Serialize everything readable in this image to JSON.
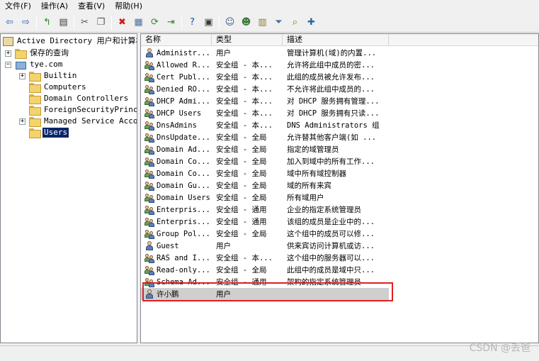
{
  "menubar": {
    "items": [
      "文件(F)",
      "操作(A)",
      "查看(V)",
      "帮助(H)"
    ]
  },
  "toolbar": {
    "buttons": [
      {
        "name": "back-arrow-icon",
        "glyph": "⇦",
        "color": "#2b5fb0"
      },
      {
        "name": "forward-arrow-icon",
        "glyph": "⇨",
        "color": "#2b5fb0"
      },
      {
        "name": "up-folder-icon",
        "glyph": "↰",
        "color": "#2c8a2c"
      },
      {
        "name": "show-console-tree-icon",
        "glyph": "▤",
        "color": "#3a3a3a"
      },
      {
        "name": "cut-icon",
        "glyph": "✂",
        "color": "#555555"
      },
      {
        "name": "copy-icon",
        "glyph": "❐",
        "color": "#555555"
      },
      {
        "name": "delete-icon",
        "glyph": "✖",
        "color": "#d01818"
      },
      {
        "name": "properties-icon",
        "glyph": "▦",
        "color": "#4a6fa0"
      },
      {
        "name": "refresh-icon",
        "glyph": "⟳",
        "color": "#2c8a2c"
      },
      {
        "name": "export-list-icon",
        "glyph": "⇥",
        "color": "#3a7a3a"
      },
      {
        "name": "help-icon",
        "glyph": "?",
        "color": "#1a4fa8"
      },
      {
        "name": "show-action-pane-icon",
        "glyph": "▣",
        "color": "#3a3a3a"
      },
      {
        "name": "new-user-icon",
        "glyph": "☺",
        "color": "#3a5a8a"
      },
      {
        "name": "new-group-icon",
        "glyph": "☻",
        "color": "#3a7a3a"
      },
      {
        "name": "new-ou-icon",
        "glyph": "▥",
        "color": "#8a7a2a"
      },
      {
        "name": "filter-icon",
        "glyph": "⏷",
        "color": "#4a6fa0"
      },
      {
        "name": "find-icon",
        "glyph": "⌕",
        "color": "#8a6a1a"
      },
      {
        "name": "add-to-group-icon",
        "glyph": "✚",
        "color": "#2c6aa0"
      }
    ]
  },
  "tree": {
    "root": "Active Directory 用户和计算机",
    "items": [
      {
        "label": "保存的查询",
        "name": "tree-item-saved-queries",
        "expander": "+",
        "icon": "folder"
      },
      {
        "label": "tye.com",
        "name": "tree-item-domain",
        "expander": "−",
        "icon": "domain"
      },
      {
        "label": "Builtin",
        "name": "tree-item-builtin",
        "expander": "+",
        "icon": "folder"
      },
      {
        "label": "Computers",
        "name": "tree-item-computers",
        "expander": "",
        "icon": "folder"
      },
      {
        "label": "Domain Controllers",
        "name": "tree-item-domain-controllers",
        "expander": "",
        "icon": "folder"
      },
      {
        "label": "ForeignSecurityPrincip",
        "name": "tree-item-foreign-security",
        "expander": "",
        "icon": "folder"
      },
      {
        "label": "Managed Service Accour",
        "name": "tree-item-managed-service",
        "expander": "+",
        "icon": "folder"
      },
      {
        "label": "Users",
        "name": "tree-item-users",
        "expander": "",
        "icon": "folder",
        "selected": true
      }
    ]
  },
  "list": {
    "columns": [
      "名称",
      "类型",
      "描述"
    ],
    "rows": [
      {
        "name": "Administr...",
        "type": "用户",
        "desc": "管理计算机(域)的内置...",
        "icon": "user"
      },
      {
        "name": "Allowed R...",
        "type": "安全组 - 本...",
        "desc": "允许将此组中成员的密...",
        "icon": "group"
      },
      {
        "name": "Cert Publ...",
        "type": "安全组 - 本...",
        "desc": "此组的成员被允许发布...",
        "icon": "group"
      },
      {
        "name": "Denied RO...",
        "type": "安全组 - 本...",
        "desc": "不允许将此组中成员的...",
        "icon": "group"
      },
      {
        "name": "DHCP Admi...",
        "type": "安全组 - 本...",
        "desc": "对 DHCP 服务拥有管理...",
        "icon": "group"
      },
      {
        "name": "DHCP Users",
        "type": "安全组 - 本...",
        "desc": "对 DHCP 服务拥有只读...",
        "icon": "group"
      },
      {
        "name": "DnsAdmins",
        "type": "安全组 - 本...",
        "desc": "DNS Administrators 组",
        "icon": "group"
      },
      {
        "name": "DnsUpdate...",
        "type": "安全组 - 全局",
        "desc": "允许替其他客户端(如 ...",
        "icon": "group"
      },
      {
        "name": "Domain Ad...",
        "type": "安全组 - 全局",
        "desc": "指定的域管理员",
        "icon": "group"
      },
      {
        "name": "Domain Co...",
        "type": "安全组 - 全局",
        "desc": "加入到域中的所有工作...",
        "icon": "group"
      },
      {
        "name": "Domain Co...",
        "type": "安全组 - 全局",
        "desc": "域中所有域控制器",
        "icon": "group"
      },
      {
        "name": "Domain Gu...",
        "type": "安全组 - 全局",
        "desc": "域的所有来宾",
        "icon": "group"
      },
      {
        "name": "Domain Users",
        "type": "安全组 - 全局",
        "desc": "所有域用户",
        "icon": "group"
      },
      {
        "name": "Enterpris...",
        "type": "安全组 - 通用",
        "desc": "企业的指定系统管理员",
        "icon": "group"
      },
      {
        "name": "Enterpris...",
        "type": "安全组 - 通用",
        "desc": "该组的成员是企业中的...",
        "icon": "group"
      },
      {
        "name": "Group Pol...",
        "type": "安全组 - 全局",
        "desc": "这个组中的成员可以修...",
        "icon": "group"
      },
      {
        "name": "Guest",
        "type": "用户",
        "desc": "供来宾访问计算机或访...",
        "icon": "user"
      },
      {
        "name": "RAS and I...",
        "type": "安全组 - 本...",
        "desc": "这个组中的服务器可以...",
        "icon": "group"
      },
      {
        "name": "Read-only...",
        "type": "安全组 - 全局",
        "desc": "此组中的成员是域中只...",
        "icon": "group"
      },
      {
        "name": "Schema Ad...",
        "type": "安全组 - 通用",
        "desc": "架构的指定系统管理员",
        "icon": "group"
      },
      {
        "name": "许小鹏",
        "type": "用户",
        "desc": "",
        "icon": "user",
        "selected": true
      }
    ]
  },
  "watermark": "CSDN @丢爸",
  "colors": {
    "selection_tree": "#0a246a",
    "selection_list": "#cfcfcf",
    "highlight_box": "#e02020"
  }
}
